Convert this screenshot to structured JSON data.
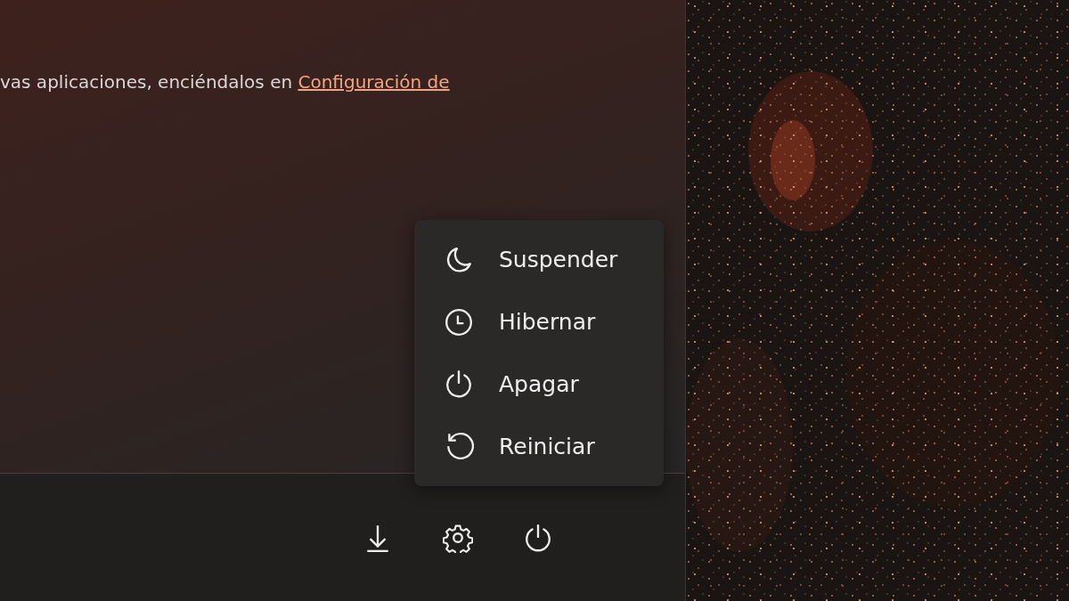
{
  "notice": {
    "text": "vas aplicaciones, enciéndalos en ",
    "link": "Configuración de"
  },
  "power_menu": {
    "items": [
      {
        "kind": "sleep",
        "label": "Suspender"
      },
      {
        "kind": "hibernate",
        "label": "Hibernar"
      },
      {
        "kind": "shutdown",
        "label": "Apagar"
      },
      {
        "kind": "restart",
        "label": "Reiniciar"
      }
    ]
  },
  "footer": {
    "buttons": [
      {
        "kind": "downloads"
      },
      {
        "kind": "settings"
      },
      {
        "kind": "power"
      }
    ]
  }
}
